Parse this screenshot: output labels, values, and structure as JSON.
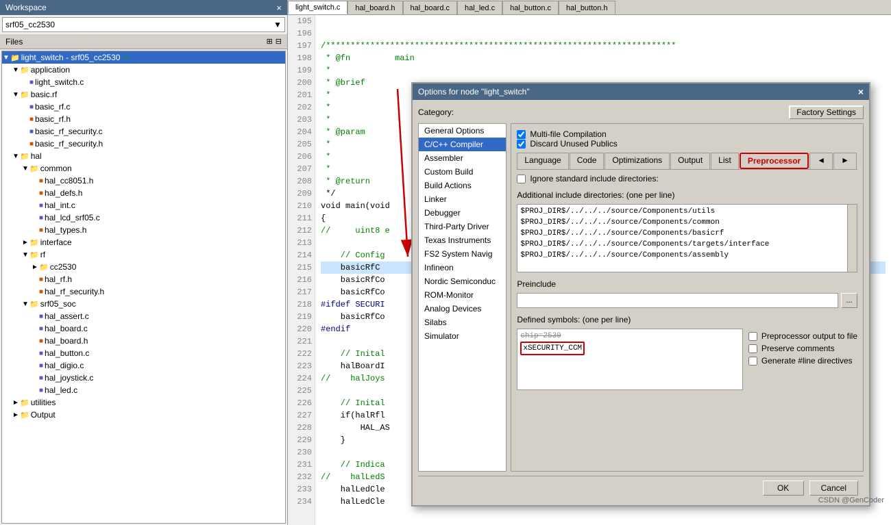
{
  "workspace": {
    "title": "Workspace",
    "dropdown_value": "srf05_cc2530",
    "files_label": "Files",
    "close_btn": "×",
    "tree": [
      {
        "id": "root",
        "label": "light_switch - srf05_cc2530",
        "level": 0,
        "type": "project",
        "expanded": true,
        "selected": true,
        "checkmark": true
      },
      {
        "id": "app",
        "label": "application",
        "level": 1,
        "type": "folder",
        "expanded": true
      },
      {
        "id": "light_switch_c",
        "label": "light_switch.c",
        "level": 2,
        "type": "c-file"
      },
      {
        "id": "basic_rf",
        "label": "basic.rf",
        "level": 1,
        "type": "folder",
        "expanded": true
      },
      {
        "id": "basic_rf_c",
        "label": "basic_rf.c",
        "level": 2,
        "type": "c-file"
      },
      {
        "id": "basic_rf_h",
        "label": "basic_rf.h",
        "level": 2,
        "type": "h-file"
      },
      {
        "id": "basic_rf_sec_c",
        "label": "basic_rf_security.c",
        "level": 2,
        "type": "c-file"
      },
      {
        "id": "basic_rf_sec_h",
        "label": "basic_rf_security.h",
        "level": 2,
        "type": "h-file"
      },
      {
        "id": "hal",
        "label": "hal",
        "level": 1,
        "type": "folder",
        "expanded": true
      },
      {
        "id": "common",
        "label": "common",
        "level": 2,
        "type": "folder",
        "expanded": true
      },
      {
        "id": "hal_cc8051_h",
        "label": "hal_cc8051.h",
        "level": 3,
        "type": "h-file"
      },
      {
        "id": "hal_defs_h",
        "label": "hal_defs.h",
        "level": 3,
        "type": "h-file"
      },
      {
        "id": "hal_int_c",
        "label": "hal_int.c",
        "level": 3,
        "type": "c-file"
      },
      {
        "id": "hal_lcd_h",
        "label": "hal_lcd_srf05.c",
        "level": 3,
        "type": "c-file"
      },
      {
        "id": "hal_types_h",
        "label": "hal_types.h",
        "level": 3,
        "type": "h-file"
      },
      {
        "id": "interface",
        "label": "interface",
        "level": 2,
        "type": "folder",
        "expanded": false
      },
      {
        "id": "rf",
        "label": "rf",
        "level": 2,
        "type": "folder",
        "expanded": true
      },
      {
        "id": "cc2530",
        "label": "cc2530",
        "level": 3,
        "type": "folder",
        "expanded": false
      },
      {
        "id": "hal_rf_h",
        "label": "hal_rf.h",
        "level": 3,
        "type": "h-file"
      },
      {
        "id": "hal_rf_sec_h",
        "label": "hal_rf_security.h",
        "level": 3,
        "type": "h-file"
      },
      {
        "id": "srf05_soc",
        "label": "srf05_soc",
        "level": 2,
        "type": "folder",
        "expanded": true
      },
      {
        "id": "hal_assert_c",
        "label": "hal_assert.c",
        "level": 3,
        "type": "c-file"
      },
      {
        "id": "hal_board_c",
        "label": "hal_board.c",
        "level": 3,
        "type": "c-file"
      },
      {
        "id": "hal_board_h",
        "label": "hal_board.h",
        "level": 3,
        "type": "h-file"
      },
      {
        "id": "hal_button_c",
        "label": "hal_button.c",
        "level": 3,
        "type": "c-file"
      },
      {
        "id": "hal_digio_c",
        "label": "hal_digio.c",
        "level": 3,
        "type": "c-file"
      },
      {
        "id": "hal_joystick_c",
        "label": "hal_joystick.c",
        "level": 3,
        "type": "c-file"
      },
      {
        "id": "hal_led_c",
        "label": "hal_led.c",
        "level": 3,
        "type": "c-file"
      },
      {
        "id": "utilities",
        "label": "utilities",
        "level": 1,
        "type": "folder",
        "expanded": false
      },
      {
        "id": "output",
        "label": "Output",
        "level": 1,
        "type": "folder",
        "expanded": false
      }
    ]
  },
  "tabs": [
    {
      "label": "light_switch.c",
      "active": true
    },
    {
      "label": "hal_board.h"
    },
    {
      "label": "hal_board.c"
    },
    {
      "label": "hal_led.c"
    },
    {
      "label": "hal_button.c"
    },
    {
      "label": "hal_button.h"
    }
  ],
  "code": {
    "lines": [
      {
        "num": "195",
        "text": ""
      },
      {
        "num": "196",
        "text": ""
      },
      {
        "num": "197",
        "text": "/***********************************************************************",
        "class": "code-comment"
      },
      {
        "num": "198",
        "text": " * @fn         main",
        "class": "code-comment"
      },
      {
        "num": "199",
        "text": " *",
        "class": "code-comment"
      },
      {
        "num": "200",
        "text": " * @brief      ",
        "class": "code-comment"
      },
      {
        "num": "201",
        "text": " *",
        "class": "code-comment"
      },
      {
        "num": "202",
        "text": " *",
        "class": "code-comment"
      },
      {
        "num": "203",
        "text": " *",
        "class": "code-comment"
      },
      {
        "num": "204",
        "text": " * @param      ",
        "class": "code-comment"
      },
      {
        "num": "205",
        "text": " *",
        "class": "code-comment"
      },
      {
        "num": "206",
        "text": " *",
        "class": "code-comment"
      },
      {
        "num": "207",
        "text": " *",
        "class": "code-comment"
      },
      {
        "num": "208",
        "text": " * @return     ",
        "class": "code-comment"
      },
      {
        "num": "209",
        "text": " */"
      },
      {
        "num": "210",
        "text": "void main(void",
        "class": ""
      },
      {
        "num": "211",
        "text": "{"
      },
      {
        "num": "212",
        "text": "//     uint8 e",
        "class": "code-comment"
      },
      {
        "num": "213",
        "text": ""
      },
      {
        "num": "214",
        "text": "    // Config",
        "class": "code-comment"
      },
      {
        "num": "215",
        "text": "    basicRfC",
        "class": "code-highlight"
      },
      {
        "num": "216",
        "text": "    basicRfCo"
      },
      {
        "num": "217",
        "text": "    basicRfCo"
      },
      {
        "num": "218",
        "text": "#ifdef SECURI",
        "class": "c-blue"
      },
      {
        "num": "219",
        "text": "    basicRfCo"
      },
      {
        "num": "220",
        "text": "#endif",
        "class": "c-blue"
      },
      {
        "num": "221",
        "text": ""
      },
      {
        "num": "222",
        "text": "    // Inital",
        "class": "code-comment"
      },
      {
        "num": "223",
        "text": "    halBoardI"
      },
      {
        "num": "224",
        "text": "//    halJoys",
        "class": "code-comment"
      },
      {
        "num": "225",
        "text": ""
      },
      {
        "num": "226",
        "text": "    // Inital",
        "class": "code-comment"
      },
      {
        "num": "227",
        "text": "    if(halRfl"
      },
      {
        "num": "228",
        "text": "        HAL_AS"
      },
      {
        "num": "229",
        "text": "    }"
      },
      {
        "num": "230",
        "text": ""
      },
      {
        "num": "231",
        "text": "    // Indica",
        "class": "code-comment"
      },
      {
        "num": "232",
        "text": "//    halLedS",
        "class": "code-comment"
      },
      {
        "num": "233",
        "text": "    halLedCle"
      },
      {
        "num": "234",
        "text": "    halLedCle"
      }
    ]
  },
  "dialog": {
    "title": "Options for node \"light_switch\"",
    "close_btn": "×",
    "category_label": "Category:",
    "factory_settings_label": "Factory Settings",
    "categories": [
      {
        "label": "General Options"
      },
      {
        "label": "C/C++ Compiler",
        "selected": true
      },
      {
        "label": "Assembler"
      },
      {
        "label": "Custom Build"
      },
      {
        "label": "Build Actions"
      },
      {
        "label": "Linker"
      },
      {
        "label": "Debugger"
      },
      {
        "label": "Third-Party Driver"
      },
      {
        "label": "Texas Instruments"
      },
      {
        "label": "FS2 System Navig"
      },
      {
        "label": "Infineon"
      },
      {
        "label": "Nordic Semiconduc"
      },
      {
        "label": "ROM-Monitor"
      },
      {
        "label": "Analog Devices"
      },
      {
        "label": "Silabs"
      },
      {
        "label": "Simulator"
      }
    ],
    "checkboxes": [
      {
        "label": "Multi-file Compilation",
        "checked": true
      },
      {
        "label": "Discard Unused Publics",
        "checked": true
      }
    ],
    "tabs": [
      {
        "label": "Language"
      },
      {
        "label": "Code"
      },
      {
        "label": "Optimizations"
      },
      {
        "label": "Output"
      },
      {
        "label": "List"
      },
      {
        "label": "Preprocessor",
        "highlighted": true
      },
      {
        "label": "◄"
      },
      {
        "label": "►"
      }
    ],
    "ignore_include": {
      "label": "Ignore standard include directories:",
      "checked": false
    },
    "additional_includes_label": "Additional include directories: (one per line)",
    "include_dirs": [
      "$PROJ_DIR$/../../../source/Components/utils",
      "$PROJ_DIR$/../../../source/Components/common",
      "$PROJ_DIR$/../../../source/Components/basicrf",
      "$PROJ_DIR$/../../../source/Components/targets/interface",
      "$PROJ_DIR$/../../../source/Components/assembly"
    ],
    "preinclude_label": "Preinclude",
    "preinclude_value": "",
    "defined_symbols_label": "Defined symbols: (one per line)",
    "defined_symbols": [
      {
        "text": "chip=2530",
        "strikethrough": true
      },
      {
        "text": "xSECURITY_CCM",
        "highlighted": true
      }
    ],
    "output_options": [
      {
        "label": "Preprocessor output to file",
        "checked": false
      },
      {
        "label": "Preserve comments",
        "checked": false
      },
      {
        "label": "Generate #line directives",
        "checked": false
      }
    ],
    "ok_label": "OK",
    "cancel_label": "Cancel"
  },
  "watermark": "CSDN @GenCoder"
}
